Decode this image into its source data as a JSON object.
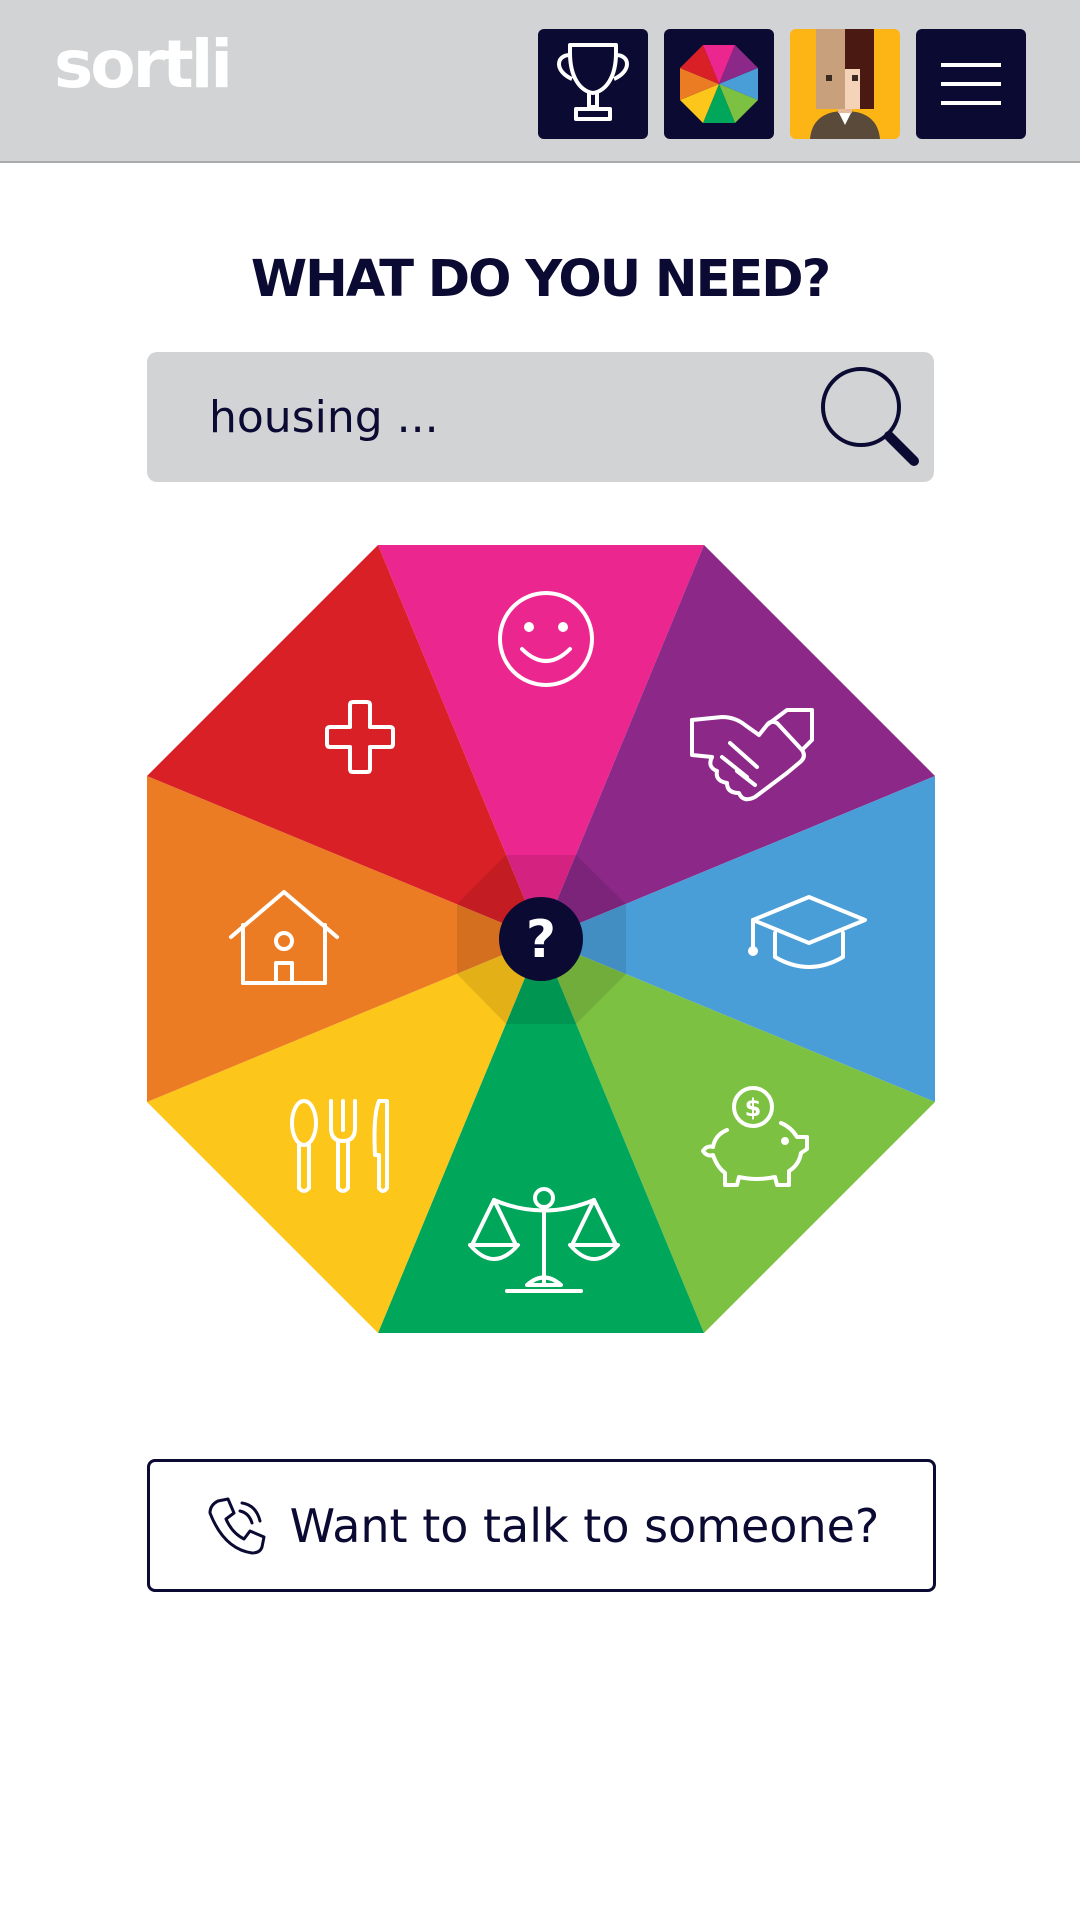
{
  "app": {
    "logo_text": "sortli"
  },
  "header": {
    "buttons": [
      {
        "name": "trophy",
        "icon": "trophy-icon"
      },
      {
        "name": "color-wheel",
        "icon": "color-wheel-icon"
      },
      {
        "name": "avatar",
        "icon": "avatar-icon"
      },
      {
        "name": "menu",
        "icon": "hamburger-menu-icon"
      }
    ],
    "colors": {
      "bar": "#d1d3d5",
      "button_bg": "#0b0a33",
      "avatar_bg": "#fdb515"
    }
  },
  "main": {
    "title": "WHAT DO YOU NEED?",
    "search": {
      "placeholder": "housing ...",
      "icon": "search-icon"
    },
    "wheel": {
      "center_label": "?",
      "segments": [
        {
          "name": "wellbeing",
          "icon": "smiley-face-icon",
          "color": "#ec268f"
        },
        {
          "name": "relationships",
          "icon": "handshake-icon",
          "color": "#8b2888"
        },
        {
          "name": "education",
          "icon": "graduation-cap-icon",
          "color": "#4a9ed8"
        },
        {
          "name": "money",
          "icon": "piggy-bank-icon",
          "color": "#7dc142"
        },
        {
          "name": "legal",
          "icon": "scales-icon",
          "color": "#00a65a"
        },
        {
          "name": "food",
          "icon": "cutlery-icon",
          "color": "#fdc61a"
        },
        {
          "name": "housing",
          "icon": "house-icon",
          "color": "#ec7c24"
        },
        {
          "name": "health",
          "icon": "medical-cross-icon",
          "color": "#da2027"
        }
      ]
    },
    "talk_button": {
      "label": "Want to talk to someone?",
      "icon": "phone-icon"
    }
  }
}
